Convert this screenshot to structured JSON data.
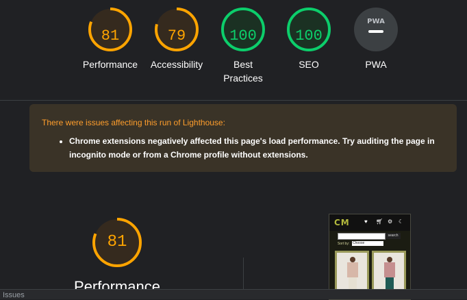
{
  "gauges": [
    {
      "score": "81",
      "label": "Performance",
      "color": "#ffa400",
      "fill_fraction": 0.81
    },
    {
      "score": "79",
      "label": "Accessibility",
      "color": "#ffa400",
      "fill_fraction": 0.79
    },
    {
      "score": "100",
      "label": "Best Practices",
      "color": "#0cce6b",
      "fill_fraction": 1.0
    },
    {
      "score": "100",
      "label": "SEO",
      "color": "#0cce6b",
      "fill_fraction": 1.0
    },
    {
      "score": "—",
      "label": "PWA",
      "badge": "PWA",
      "color": "#9aa0a6",
      "fill_fraction": 0
    }
  ],
  "warning": {
    "title": "There were issues affecting this run of Lighthouse:",
    "items": [
      "Chrome extensions negatively affected this page's load performance. Try auditing the page in incognito mode or from a Chrome profile without extensions."
    ]
  },
  "performance_section": {
    "score": "81",
    "label": "Performance",
    "color": "#ffa400",
    "fill_fraction": 0.81
  },
  "thumbnail": {
    "logo": "CM",
    "search_button": "search",
    "sort_label": "Sort by:",
    "sort_value": "Choose"
  },
  "status_bar": {
    "label": "Issues"
  }
}
